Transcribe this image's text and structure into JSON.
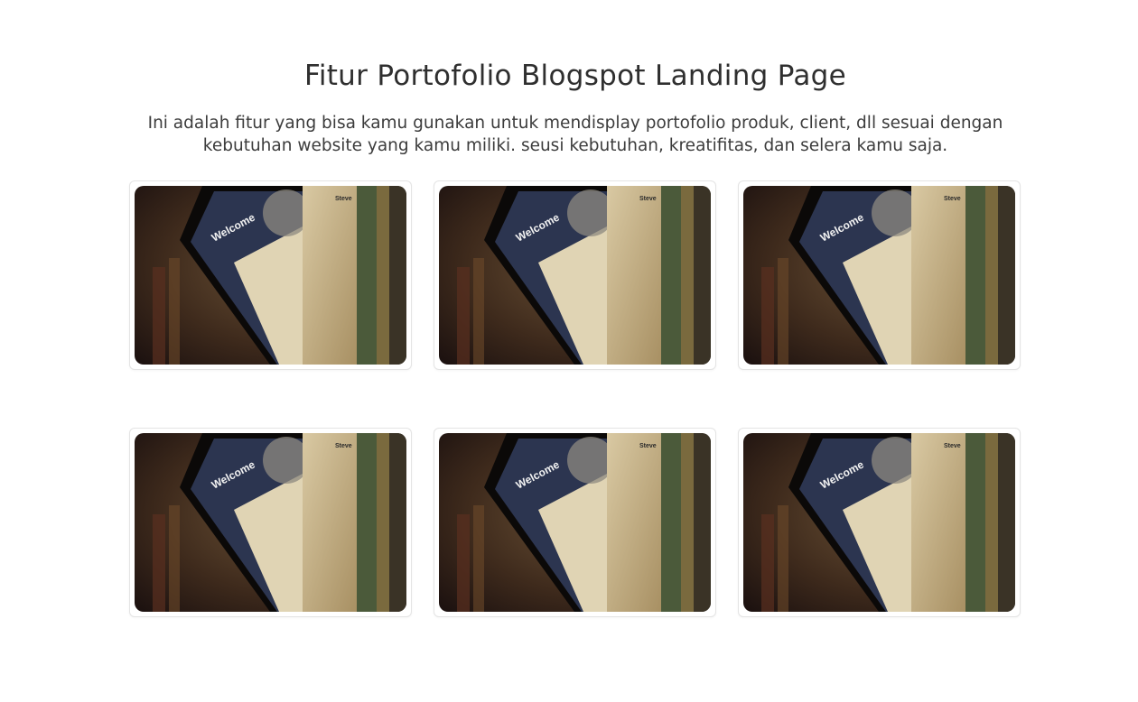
{
  "portfolio": {
    "title": "Fitur Portofolio Blogspot Landing Page",
    "description": "Ini adalah fitur yang bisa kamu gunakan untuk mendisplay portofolio produk, client, dll sesuai dengan kebutuhan website yang kamu miliki. seusi kebutuhan, kreatifitas, dan selera kamu saja.",
    "items": [
      {
        "screen_heading": "Welcome",
        "book_label": "Steve"
      },
      {
        "screen_heading": "Welcome",
        "book_label": "Steve"
      },
      {
        "screen_heading": "Welcome",
        "book_label": "Steve"
      },
      {
        "screen_heading": "Welcome",
        "book_label": "Steve"
      },
      {
        "screen_heading": "Welcome",
        "book_label": "Steve"
      },
      {
        "screen_heading": "Welcome",
        "book_label": "Steve"
      }
    ]
  }
}
